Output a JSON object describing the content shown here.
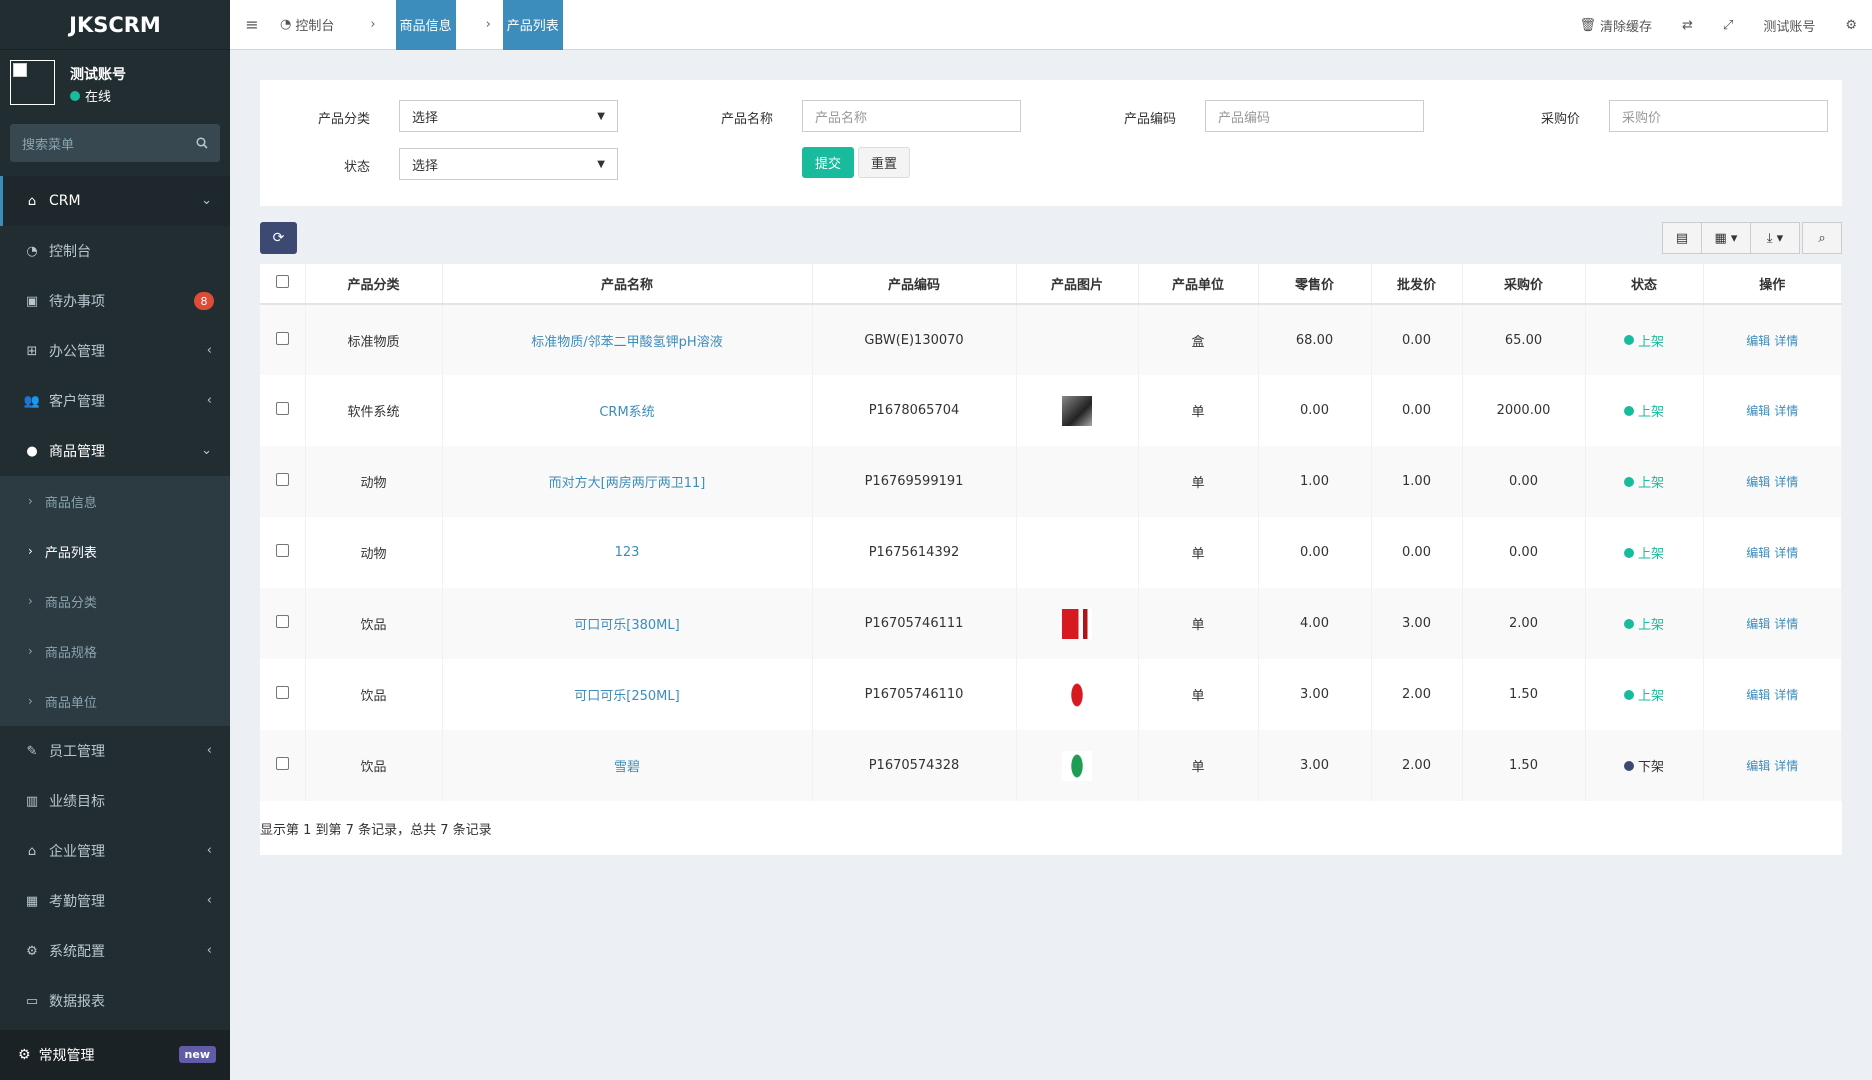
{
  "app": {
    "logo": "JKSCRM"
  },
  "user": {
    "name": "测试账号",
    "status": "在线",
    "status_color": "#18bc9c"
  },
  "sidebar": {
    "search_placeholder": "搜索菜单",
    "items": [
      {
        "label": "CRM",
        "icon": "home-icon"
      },
      {
        "label": "控制台",
        "icon": "dashboard-icon"
      },
      {
        "label": "待办事项",
        "icon": "calendar-icon",
        "badge": "8"
      },
      {
        "label": "办公管理",
        "icon": "windows-icon"
      },
      {
        "label": "客户管理",
        "icon": "users-icon"
      },
      {
        "label": "商品管理",
        "icon": "product-icon"
      },
      {
        "label": "员工管理",
        "icon": "brush-icon"
      },
      {
        "label": "业绩目标",
        "icon": "bar-chart-icon"
      },
      {
        "label": "企业管理",
        "icon": "bank-icon"
      },
      {
        "label": "考勤管理",
        "icon": "calendar-icon"
      },
      {
        "label": "系统配置",
        "icon": "gear-icon"
      },
      {
        "label": "数据报表",
        "icon": "laptop-icon"
      }
    ],
    "sub_items": [
      "商品信息",
      "产品列表",
      "商品分类",
      "商品规格",
      "商品单位"
    ],
    "bottom": {
      "label": "常规管理",
      "badge": "new"
    }
  },
  "topbar": {
    "tabs": [
      "控制台",
      "商品信息",
      "产品列表"
    ],
    "right": {
      "clear_cache": "清除缓存",
      "account": "测试账号"
    }
  },
  "filter": {
    "category_label": "产品分类",
    "category_value": "选择",
    "name_label": "产品名称",
    "name_placeholder": "产品名称",
    "code_label": "产品编码",
    "code_placeholder": "产品编码",
    "cost_label": "采购价",
    "cost_placeholder": "采购价",
    "status_label": "状态",
    "status_value": "选择",
    "submit": "提交",
    "reset": "重置"
  },
  "table": {
    "headers": [
      "产品分类",
      "产品名称",
      "产品编码",
      "产品图片",
      "产品单位",
      "零售价",
      "批发价",
      "采购价",
      "状态",
      "操作"
    ],
    "rows": [
      {
        "category": "标准物质",
        "name": "标准物质/邻苯二甲酸氢钾pH溶液",
        "code": "GBW(E)130070",
        "unit": "盒",
        "retail": "68.00",
        "wholesale": "0.00",
        "cost": "65.00",
        "status": "上架",
        "edit": "编辑",
        "detail": "详情"
      },
      {
        "category": "软件系统",
        "name": "CRM系统",
        "code": "P1678065704",
        "unit": "单",
        "retail": "0.00",
        "wholesale": "0.00",
        "cost": "2000.00",
        "status": "上架",
        "edit": "编辑",
        "detail": "详情"
      },
      {
        "category": "动物",
        "name": "而对方大[两房两厅两卫11]",
        "code": "P16769599191",
        "unit": "单",
        "retail": "1.00",
        "wholesale": "1.00",
        "cost": "0.00",
        "status": "上架",
        "edit": "编辑",
        "detail": "详情"
      },
      {
        "category": "动物",
        "name": "123",
        "code": "P1675614392",
        "unit": "单",
        "retail": "0.00",
        "wholesale": "0.00",
        "cost": "0.00",
        "status": "上架",
        "edit": "编辑",
        "detail": "详情"
      },
      {
        "category": "饮品",
        "name": "可口可乐[380ML]",
        "code": "P16705746111",
        "unit": "单",
        "retail": "4.00",
        "wholesale": "3.00",
        "cost": "2.00",
        "status": "上架",
        "edit": "编辑",
        "detail": "详情"
      },
      {
        "category": "饮品",
        "name": "可口可乐[250ML]",
        "code": "P16705746110",
        "unit": "单",
        "retail": "3.00",
        "wholesale": "2.00",
        "cost": "1.50",
        "status": "上架",
        "edit": "编辑",
        "detail": "详情"
      },
      {
        "category": "饮品",
        "name": "雪碧",
        "code": "P1670574328",
        "unit": "单",
        "retail": "3.00",
        "wholesale": "2.00",
        "cost": "1.50",
        "status": "下架",
        "edit": "编辑",
        "detail": "详情"
      }
    ],
    "footer": "显示第 1 到第 7 条记录，总共 7 条记录"
  },
  "colors": {
    "sidebar": "#222d32",
    "accent": "#3c8dbc",
    "success": "#18bc9c",
    "inactive": "#3c4a73",
    "danger": "#dd4b39"
  }
}
